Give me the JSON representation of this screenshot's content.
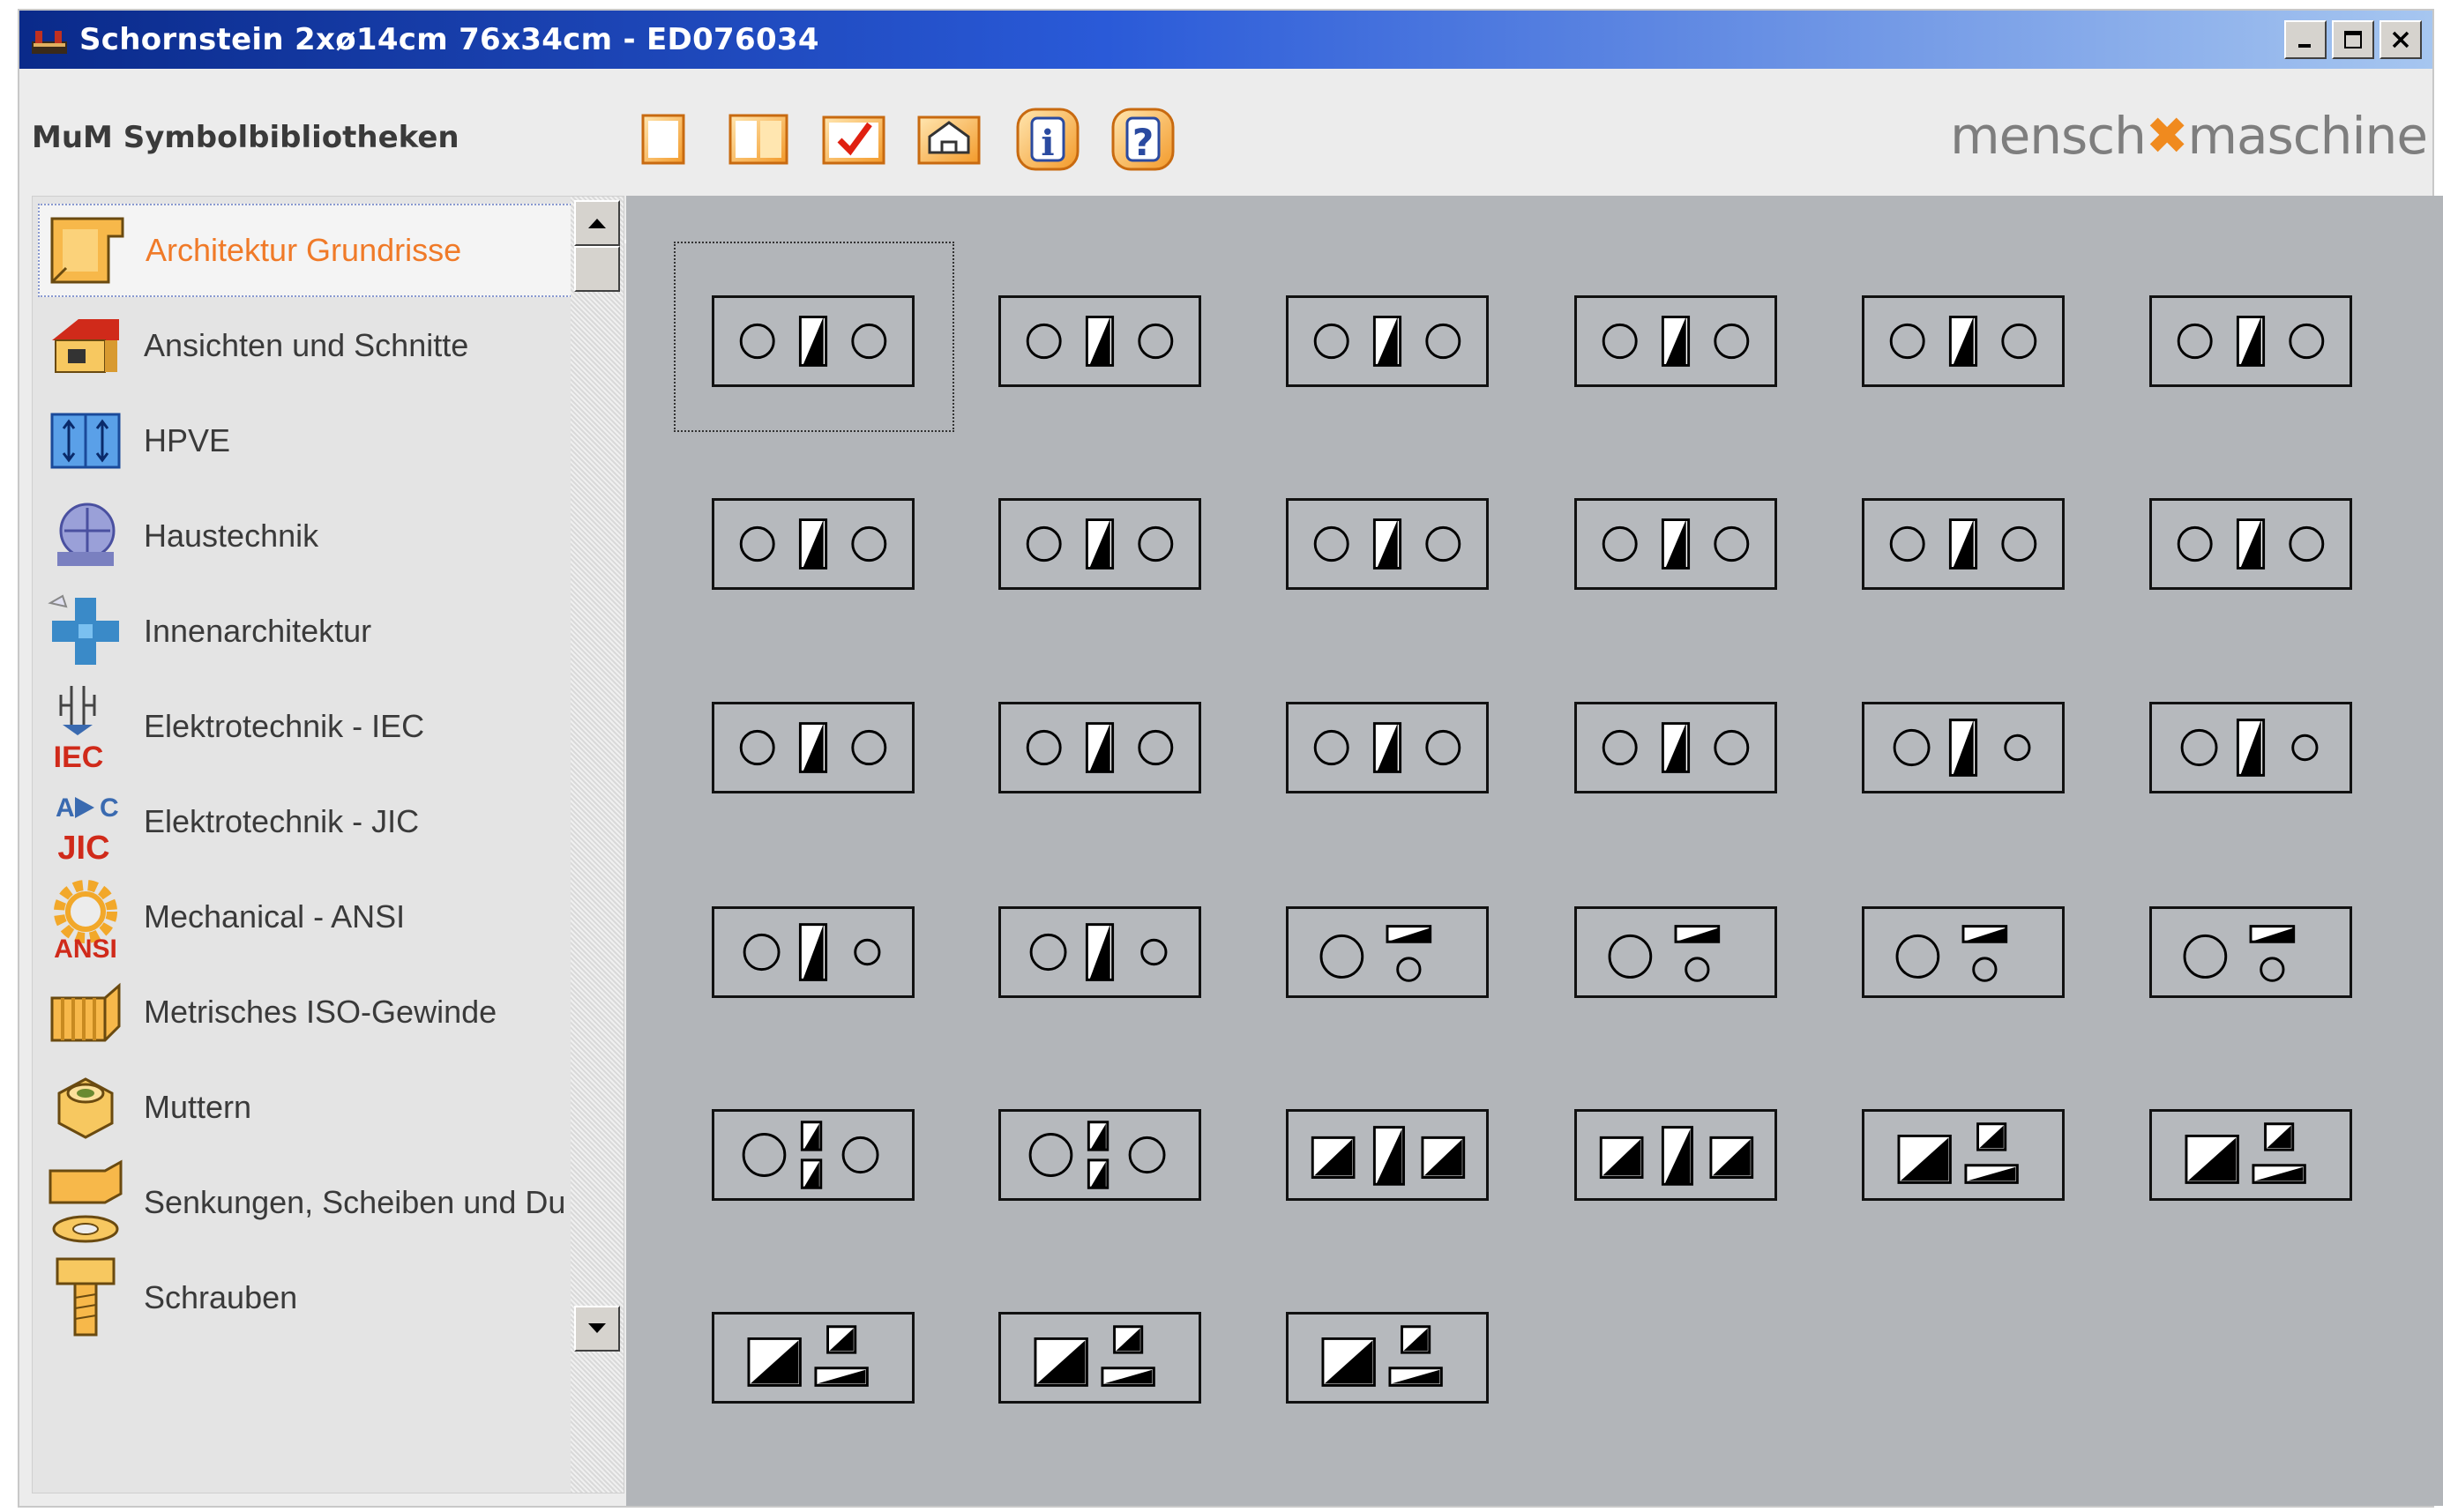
{
  "window": {
    "title": "Schornstein 2xø14cm 76x34cm - ED076034",
    "controls": {
      "minimize": "minimize",
      "maximize": "maximize",
      "close": "close"
    }
  },
  "toolbar": {
    "library_title": "MuM Symbolbibliotheken",
    "tools": [
      {
        "icon": "single-frame-icon"
      },
      {
        "icon": "double-frame-icon"
      },
      {
        "icon": "checkmark-icon"
      },
      {
        "icon": "house-edit-icon"
      },
      {
        "icon": "info-icon"
      },
      {
        "icon": "help-icon"
      }
    ],
    "brand_left": "mensch",
    "brand_mark": "✖",
    "brand_right": "maschine"
  },
  "categories": [
    {
      "label": "Architektur Grundrisse",
      "icon": "floorplan-icon",
      "selected": true
    },
    {
      "label": "Ansichten und Schnitte",
      "icon": "house-icon",
      "selected": false
    },
    {
      "label": "HPVE",
      "icon": "hpve-icon",
      "selected": false
    },
    {
      "label": "Haustechnik",
      "icon": "building-services-icon",
      "selected": false
    },
    {
      "label": "Innenarchitektur",
      "icon": "interior-icon",
      "selected": false
    },
    {
      "label": "Elektrotechnik - IEC",
      "icon": "iec-icon",
      "icon_text": "IEC",
      "selected": false
    },
    {
      "label": "Elektrotechnik - JIC",
      "icon": "jic-icon",
      "icon_text": "JIC",
      "selected": false
    },
    {
      "label": "Mechanical - ANSI",
      "icon": "ansi-gear-icon",
      "icon_text": "ANSI",
      "selected": false
    },
    {
      "label": "Metrisches ISO-Gewinde",
      "icon": "thread-icon",
      "selected": false
    },
    {
      "label": "Muttern",
      "icon": "nut-icon",
      "selected": false
    },
    {
      "label": "Senkungen, Scheiben und Du",
      "icon": "washer-icon",
      "selected": false
    },
    {
      "label": "Schrauben",
      "icon": "screw-icon",
      "selected": false
    }
  ],
  "colors": {
    "accent_orange": "#f07a28",
    "icon_orange": "#f5a53a",
    "grid_bg": "#b2b5b9",
    "titlebar_dark": "#0a2a8a"
  },
  "symbols": {
    "rows": [
      [
        "circle-bar-circle",
        "circle-bar-circle",
        "circle-bar-circle",
        "circle-bar-circle",
        "circle-bar-circle",
        "circle-bar-circle"
      ],
      [
        "circle-bar-circle",
        "circle-bar-circle",
        "circle-bar-circle",
        "circle-bar-circle",
        "circle-bar-circle",
        "circle-bar-circle"
      ],
      [
        "circle-bar-circle",
        "circle-bar-circle",
        "circle-bar-circle",
        "circle-bar-circle",
        "circle-bar-small-circle",
        "circle-bar-small-circle"
      ],
      [
        "circle-bar-small-circle",
        "circle-bar-small-circle",
        "circle-two-bars",
        "circle-two-bars",
        "circle-two-bars",
        "circle-two-bars"
      ],
      [
        "circle-split-circle",
        "circle-split-circle",
        "triangle-bar-triangle",
        "triangle-bar-triangle",
        "triangle-split",
        "triangle-split"
      ],
      [
        "triangle-split",
        "triangle-split",
        "triangle-split"
      ]
    ],
    "selected_index": 0
  }
}
